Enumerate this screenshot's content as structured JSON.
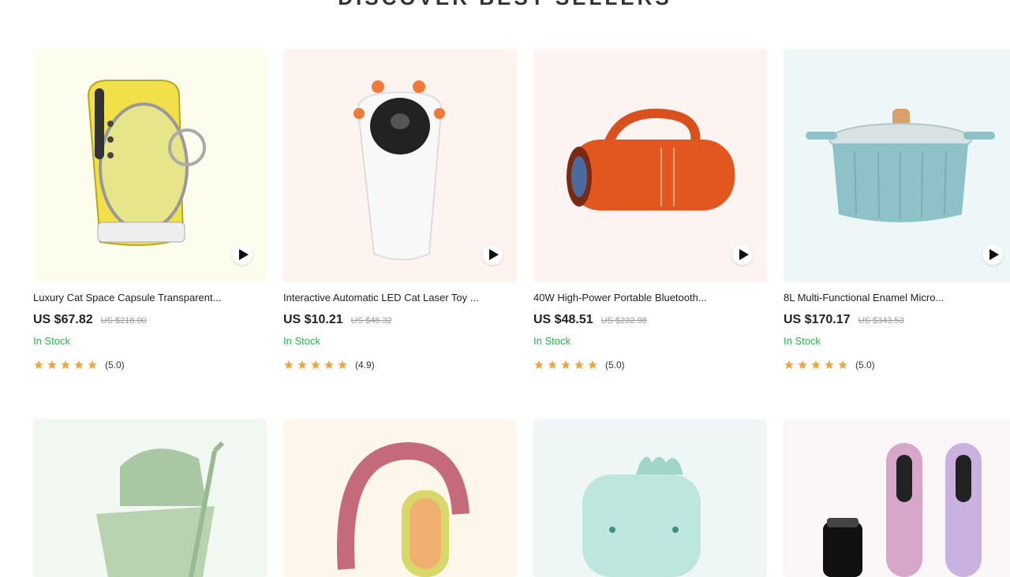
{
  "section": {
    "title": "DISCOVER BEST SELLERS"
  },
  "colors": {
    "accent_star": "#f0a53a",
    "in_stock": "#2db34a"
  },
  "products": [
    {
      "name": "Luxury Cat Space Capsule Transparent...",
      "price": "US $67.82",
      "old_price": "US $218.00",
      "stock": "In Stock",
      "rating": "(5.0)",
      "stars": 5,
      "bg": "#fdfdee"
    },
    {
      "name": "Interactive Automatic LED Cat Laser Toy ...",
      "price": "US $10.21",
      "old_price": "US $48.32",
      "stock": "In Stock",
      "rating": "(4.9)",
      "stars": 5,
      "bg": "#fdf4f0"
    },
    {
      "name": "40W High-Power Portable Bluetooth...",
      "price": "US $48.51",
      "old_price": "US $232.98",
      "stock": "In Stock",
      "rating": "(5.0)",
      "stars": 5,
      "bg": "#fdf3f1"
    },
    {
      "name": "8L Multi-Functional Enamel Micro...",
      "price": "US $170.17",
      "old_price": "US $343.53",
      "stock": "In Stock",
      "rating": "(5.0)",
      "stars": 5,
      "bg": "#eef7f7"
    }
  ],
  "products_row2": [
    {
      "bg": "#f1f7f1"
    },
    {
      "bg": "#fdf6ea"
    },
    {
      "bg": "#eef7f5"
    },
    {
      "bg": "#fbf6f8"
    }
  ]
}
